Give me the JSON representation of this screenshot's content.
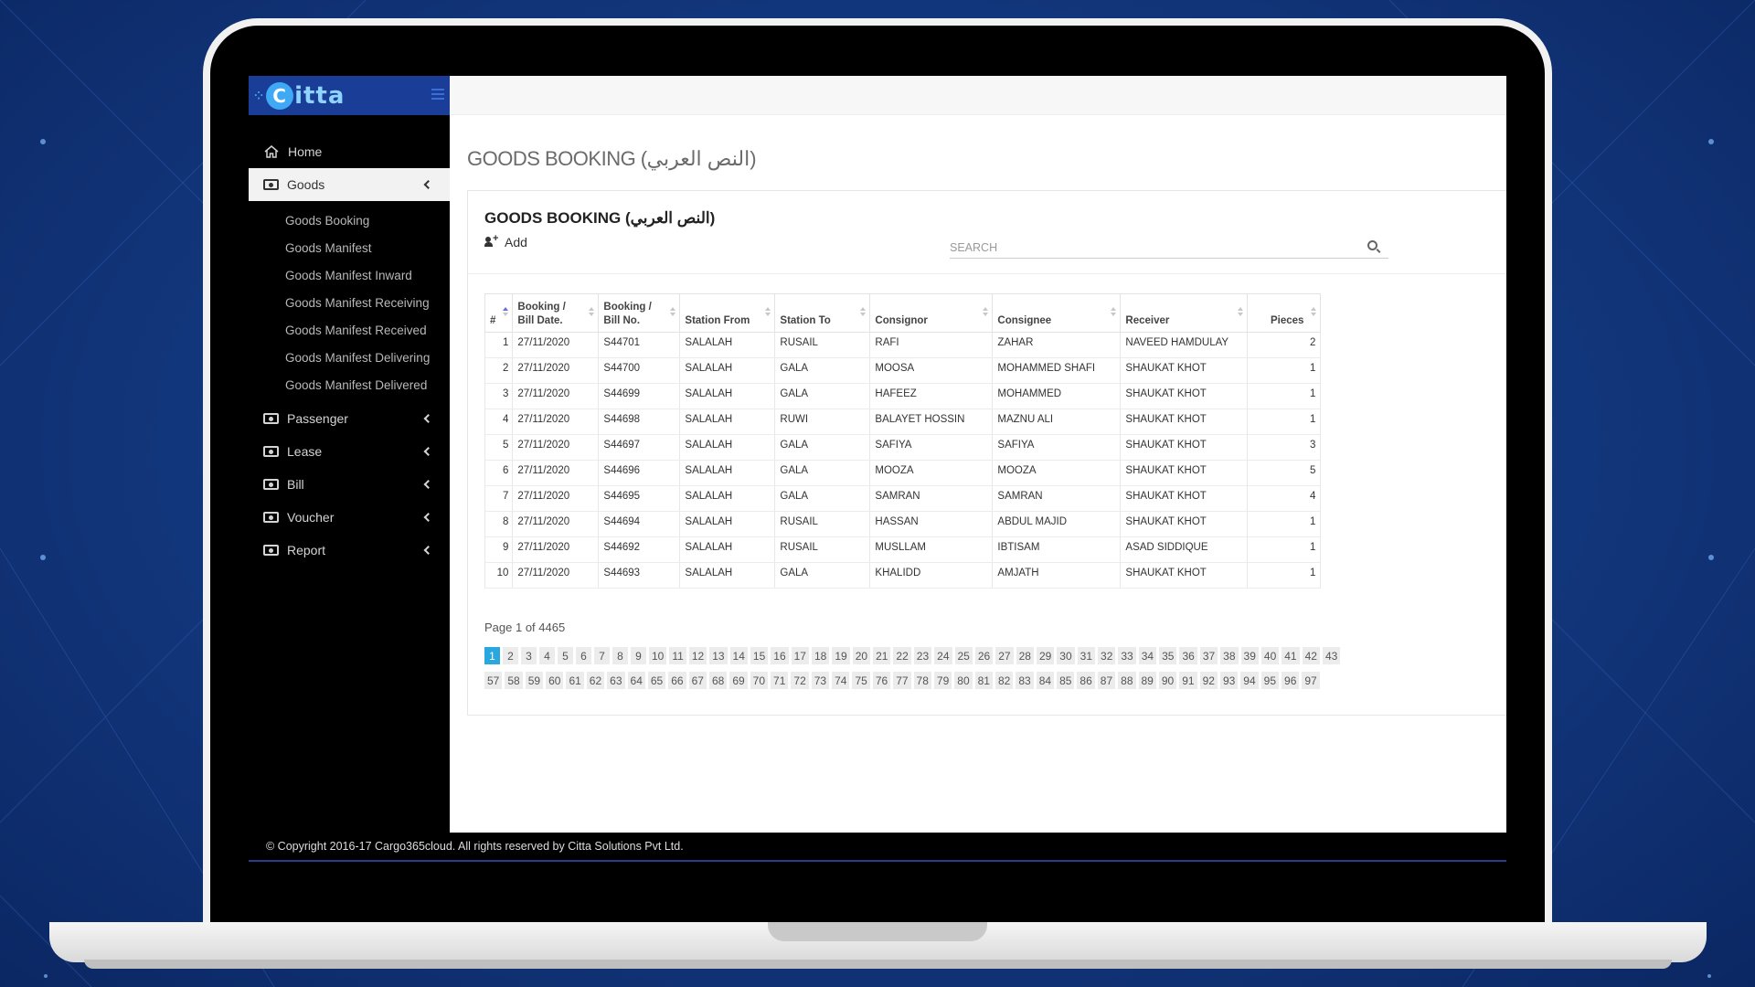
{
  "brand": {
    "logo_text": "itta",
    "logo_letter": "C"
  },
  "sidebar": {
    "items": [
      {
        "label": "Home",
        "icon": "home-icon"
      },
      {
        "label": "Goods",
        "icon": "money-icon",
        "active": true
      },
      {
        "label": "Passenger",
        "icon": "money-icon"
      },
      {
        "label": "Lease",
        "icon": "money-icon"
      },
      {
        "label": "Bill",
        "icon": "money-icon"
      },
      {
        "label": "Voucher",
        "icon": "money-icon"
      },
      {
        "label": "Report",
        "icon": "money-icon"
      }
    ],
    "goods_sub": [
      "Goods Booking",
      "Goods Manifest",
      "Goods Manifest Inward",
      "Goods Manifest Receiving",
      "Goods Manifest Received",
      "Goods Manifest Delivering",
      "Goods Manifest Delivered"
    ]
  },
  "page": {
    "title": "GOODS BOOKING (النص العربي)",
    "panel_title": "GOODS BOOKING (النص العربي)",
    "add_label": "Add",
    "search_placeholder": "SEARCH",
    "page_info": "Page 1 of 4465"
  },
  "table": {
    "headers": [
      "#",
      "Booking / Bill Date.",
      "Booking / Bill No.",
      "Station From",
      "Station To",
      "Consignor",
      "Consignee",
      "Receiver",
      "Pieces"
    ],
    "rows": [
      [
        "1",
        "27/11/2020",
        "S44701",
        "SALALAH",
        "RUSAIL",
        "RAFI",
        "ZAHAR",
        "NAVEED HAMDULAY",
        "2"
      ],
      [
        "2",
        "27/11/2020",
        "S44700",
        "SALALAH",
        "GALA",
        "MOOSA",
        "MOHAMMED SHAFI",
        "SHAUKAT KHOT",
        "1"
      ],
      [
        "3",
        "27/11/2020",
        "S44699",
        "SALALAH",
        "GALA",
        "HAFEEZ",
        "MOHAMMED",
        "SHAUKAT KHOT",
        "1"
      ],
      [
        "4",
        "27/11/2020",
        "S44698",
        "SALALAH",
        "RUWI",
        "BALAYET HOSSIN",
        "MAZNU ALI",
        "SHAUKAT KHOT",
        "1"
      ],
      [
        "5",
        "27/11/2020",
        "S44697",
        "SALALAH",
        "GALA",
        "SAFIYA",
        "SAFIYA",
        "SHAUKAT KHOT",
        "3"
      ],
      [
        "6",
        "27/11/2020",
        "S44696",
        "SALALAH",
        "GALA",
        "MOOZA",
        "MOOZA",
        "SHAUKAT KHOT",
        "5"
      ],
      [
        "7",
        "27/11/2020",
        "S44695",
        "SALALAH",
        "GALA",
        "SAMRAN",
        "SAMRAN",
        "SHAUKAT KHOT",
        "4"
      ],
      [
        "8",
        "27/11/2020",
        "S44694",
        "SALALAH",
        "RUSAIL",
        "HASSAN",
        "ABDUL MAJID",
        "SHAUKAT KHOT",
        "1"
      ],
      [
        "9",
        "27/11/2020",
        "S44692",
        "SALALAH",
        "RUSAIL",
        "MUSLLAM",
        "IBTISAM",
        "ASAD SIDDIQUE",
        "1"
      ],
      [
        "10",
        "27/11/2020",
        "S44693",
        "SALALAH",
        "GALA",
        "KHALIDD",
        "AMJATH",
        "SHAUKAT KHOT",
        "1"
      ]
    ]
  },
  "pagination": {
    "current": "1",
    "row1": [
      "1",
      "2",
      "3",
      "4",
      "5",
      "6",
      "7",
      "8",
      "9",
      "10",
      "11",
      "12",
      "13",
      "14",
      "15",
      "16",
      "17",
      "18",
      "19",
      "20",
      "21",
      "22",
      "23",
      "24",
      "25",
      "26",
      "27",
      "28",
      "29",
      "30",
      "31",
      "32",
      "33",
      "34",
      "35",
      "36",
      "37",
      "38",
      "39",
      "40",
      "41",
      "42",
      "43"
    ],
    "row2": [
      "57",
      "58",
      "59",
      "60",
      "61",
      "62",
      "63",
      "64",
      "65",
      "66",
      "67",
      "68",
      "69",
      "70",
      "71",
      "72",
      "73",
      "74",
      "75",
      "76",
      "77",
      "78",
      "79",
      "80",
      "81",
      "82",
      "83",
      "84",
      "85",
      "86",
      "87",
      "88",
      "89",
      "90",
      "91",
      "92",
      "93",
      "94",
      "95",
      "96",
      "97"
    ]
  },
  "footer": {
    "text": "© Copyright 2016-17 Cargo365cloud. All rights reserved by Citta Solutions Pvt Ltd."
  },
  "colors": {
    "brand": "#1a3d98",
    "accent": "#2aa7de",
    "sidebar": "#000000",
    "background": "#143a82"
  }
}
